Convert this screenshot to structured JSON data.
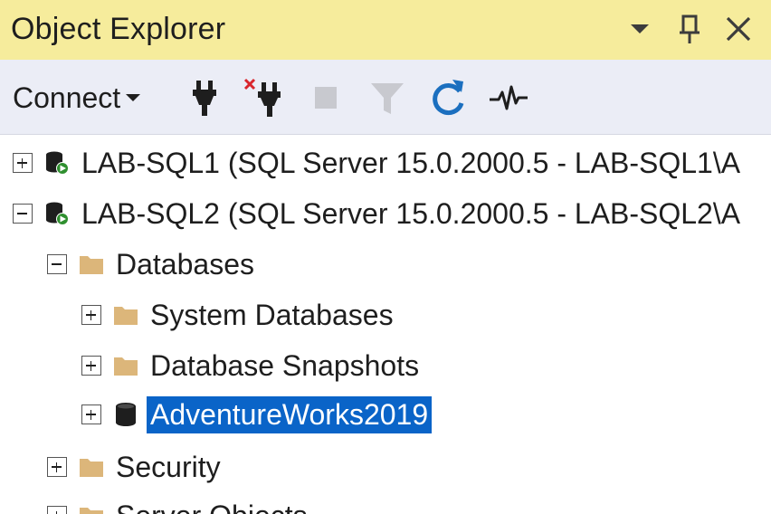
{
  "window": {
    "title": "Object Explorer"
  },
  "toolbar": {
    "connect_label": "Connect"
  },
  "tree": {
    "nodes": [
      {
        "label": "LAB-SQL1 (SQL Server 15.0.2000.5 - LAB-SQL1\\A",
        "expanded": false,
        "icon": "server-connected-icon"
      },
      {
        "label": "LAB-SQL2 (SQL Server 15.0.2000.5 - LAB-SQL2\\A",
        "expanded": true,
        "icon": "server-connected-icon"
      },
      {
        "label": "Databases",
        "expanded": true,
        "icon": "folder-icon"
      },
      {
        "label": "System Databases",
        "expanded": false,
        "icon": "folder-icon"
      },
      {
        "label": "Database Snapshots",
        "expanded": false,
        "icon": "folder-icon"
      },
      {
        "label": "AdventureWorks2019",
        "expanded": false,
        "icon": "database-icon",
        "selected": true
      },
      {
        "label": "Security",
        "expanded": false,
        "icon": "folder-icon"
      },
      {
        "label": "Server Objects",
        "expanded": false,
        "icon": "folder-icon"
      }
    ]
  },
  "colors": {
    "title_bar": "#f6ec9c",
    "toolbar": "#ebedf6",
    "selection": "#0a64c8",
    "refresh_blue": "#1b6fbf",
    "disconnect_red": "#d9262c",
    "server_green": "#2f8f2f",
    "folder": "#dcb67a"
  }
}
